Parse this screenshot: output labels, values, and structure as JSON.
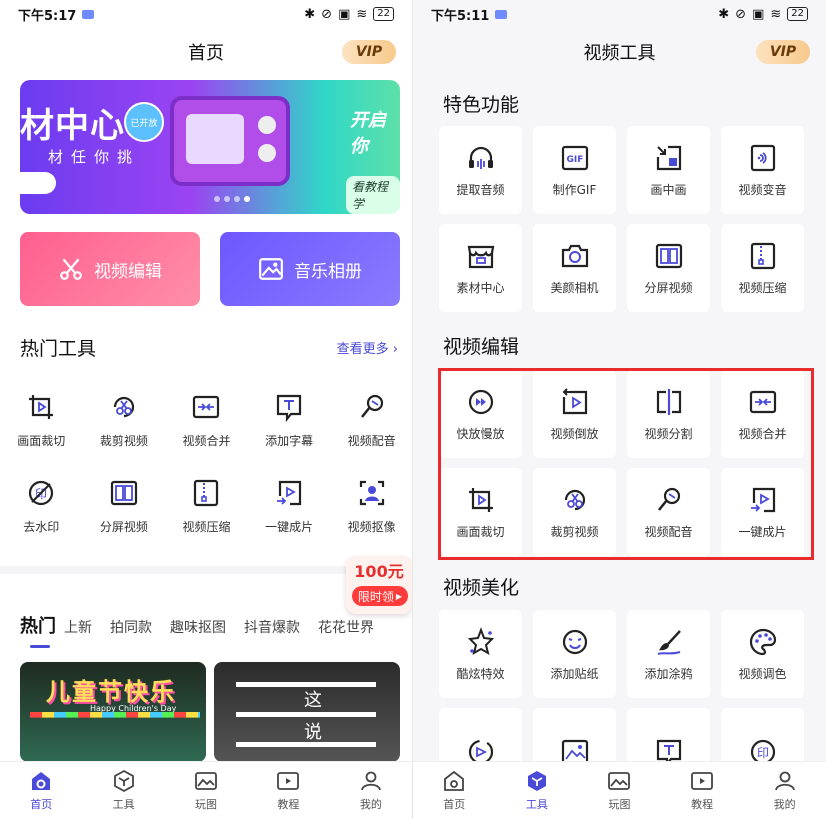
{
  "left": {
    "status": {
      "time": "下午5:17",
      "battery": "22"
    },
    "title": "首页",
    "vip_label": "VIP",
    "banner": {
      "text_main": "材中心",
      "text_sub": "材任你挑",
      "badge": "已开放",
      "text_right": "开启你",
      "text_right_sub": "看教程学"
    },
    "big_buttons": [
      {
        "label": "视频编辑",
        "icon": "scissors-icon"
      },
      {
        "label": "音乐相册",
        "icon": "image-icon"
      }
    ],
    "hot_tools": {
      "title": "热门工具",
      "see_more": "查看更多",
      "items": [
        {
          "label": "画面裁切",
          "icon": "crop-icon"
        },
        {
          "label": "裁剪视频",
          "icon": "cut-video-icon"
        },
        {
          "label": "视频合并",
          "icon": "merge-icon"
        },
        {
          "label": "添加字幕",
          "icon": "subtitle-icon"
        },
        {
          "label": "视频配音",
          "icon": "dub-icon"
        },
        {
          "label": "去水印",
          "icon": "watermark-icon"
        },
        {
          "label": "分屏视频",
          "icon": "split-screen-icon"
        },
        {
          "label": "视频压缩",
          "icon": "compress-icon"
        },
        {
          "label": "一键成片",
          "icon": "one-click-icon"
        },
        {
          "label": "视频抠像",
          "icon": "matting-icon"
        }
      ]
    },
    "promo": {
      "amount": "100元",
      "tag": "限时领"
    },
    "tabs": [
      "热门",
      "上新",
      "拍同款",
      "趣味抠图",
      "抖音爆款",
      "花花世界"
    ],
    "thumb1": {
      "title": "儿童节快乐",
      "sub": "Happy Children's Day"
    },
    "thumb2": {
      "c1": "这",
      "c2": "说"
    },
    "bottom_nav": [
      {
        "label": "首页",
        "icon": "home-icon",
        "active": true
      },
      {
        "label": "工具",
        "icon": "tool-icon",
        "active": false
      },
      {
        "label": "玩图",
        "icon": "picture-icon",
        "active": false
      },
      {
        "label": "教程",
        "icon": "tutorial-icon",
        "active": false
      },
      {
        "label": "我的",
        "icon": "profile-icon",
        "active": false
      }
    ]
  },
  "right": {
    "status": {
      "time": "下午5:11",
      "battery": "22"
    },
    "title": "视频工具",
    "vip_label": "VIP",
    "sections": [
      {
        "title": "特色功能",
        "items": [
          {
            "label": "提取音频",
            "icon": "audio-extract-icon"
          },
          {
            "label": "制作GIF",
            "icon": "gif-icon"
          },
          {
            "label": "画中画",
            "icon": "pip-icon"
          },
          {
            "label": "视频变音",
            "icon": "voice-change-icon"
          },
          {
            "label": "素材中心",
            "icon": "store-icon"
          },
          {
            "label": "美颜相机",
            "icon": "camera-icon"
          },
          {
            "label": "分屏视频",
            "icon": "split-screen-icon"
          },
          {
            "label": "视频压缩",
            "icon": "compress-icon"
          }
        ]
      },
      {
        "title": "视频编辑",
        "items": [
          {
            "label": "快放慢放",
            "icon": "speed-icon"
          },
          {
            "label": "视频倒放",
            "icon": "reverse-icon"
          },
          {
            "label": "视频分割",
            "icon": "split-icon"
          },
          {
            "label": "视频合并",
            "icon": "merge-icon"
          },
          {
            "label": "画面裁切",
            "icon": "crop-icon"
          },
          {
            "label": "裁剪视频",
            "icon": "cut-video-icon"
          },
          {
            "label": "视频配音",
            "icon": "dub-icon"
          },
          {
            "label": "一键成片",
            "icon": "one-click-icon"
          }
        ]
      },
      {
        "title": "视频美化",
        "items": [
          {
            "label": "酷炫特效",
            "icon": "effects-icon"
          },
          {
            "label": "添加贴纸",
            "icon": "sticker-icon"
          },
          {
            "label": "添加涂鸦",
            "icon": "brush-icon"
          },
          {
            "label": "视频调色",
            "icon": "palette-icon"
          }
        ]
      }
    ],
    "bottom_nav": [
      {
        "label": "首页",
        "icon": "home-icon",
        "active": false
      },
      {
        "label": "工具",
        "icon": "tool-icon",
        "active": true
      },
      {
        "label": "玩图",
        "icon": "picture-icon",
        "active": false
      },
      {
        "label": "教程",
        "icon": "tutorial-icon",
        "active": false
      },
      {
        "label": "我的",
        "icon": "profile-icon",
        "active": false
      }
    ]
  },
  "colors": {
    "accent": "#4a4ad8",
    "highlight": "#ea2b2b",
    "pink": "#ff5f8f",
    "purple": "#6d57ff"
  }
}
